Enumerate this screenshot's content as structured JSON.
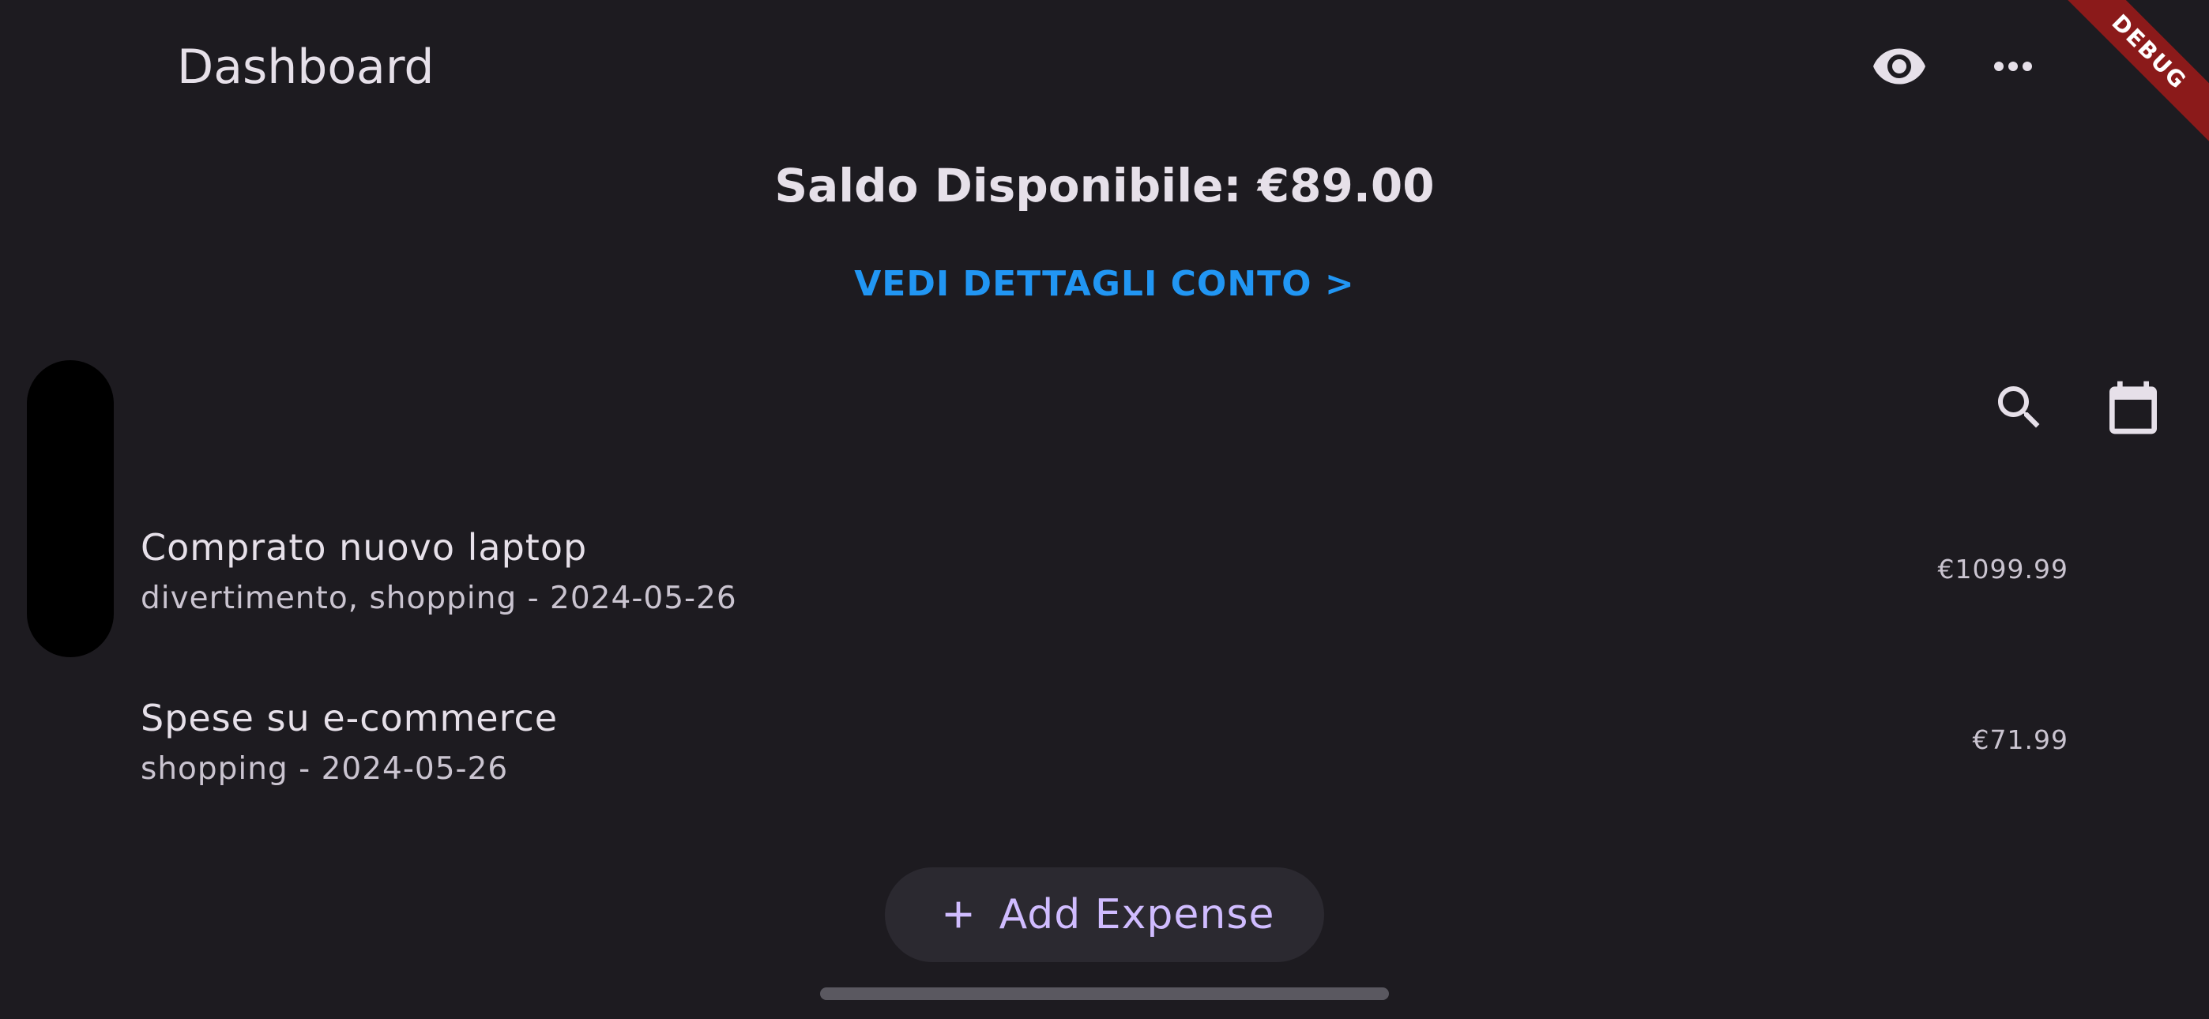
{
  "app_bar": {
    "title": "Dashboard",
    "actions": [
      {
        "icon": "eye-icon"
      },
      {
        "icon": "more-horiz-icon"
      }
    ]
  },
  "debug_banner": "DEBUG",
  "balance": {
    "text": "Saldo Disponibile: €89.00"
  },
  "account_link": "VEDI DETTAGLI CONTO >",
  "toolbar": {
    "search_icon": "search-icon",
    "calendar_icon": "calendar-icon"
  },
  "expenses": [
    {
      "title": "Comprato nuovo laptop",
      "subtitle": "divertimento, shopping - 2024-05-26",
      "amount": "€1099.99"
    },
    {
      "title": "Spese su e-commerce",
      "subtitle": "shopping - 2024-05-26",
      "amount": "€71.99"
    }
  ],
  "fab": {
    "label": "Add Expense",
    "icon": "plus-icon"
  },
  "colors": {
    "background": "#1d1b20",
    "link": "#2196f3",
    "fab_background": "#2b2930",
    "fab_text": "#d0bcff",
    "debug_ribbon": "#8b1a1a"
  }
}
